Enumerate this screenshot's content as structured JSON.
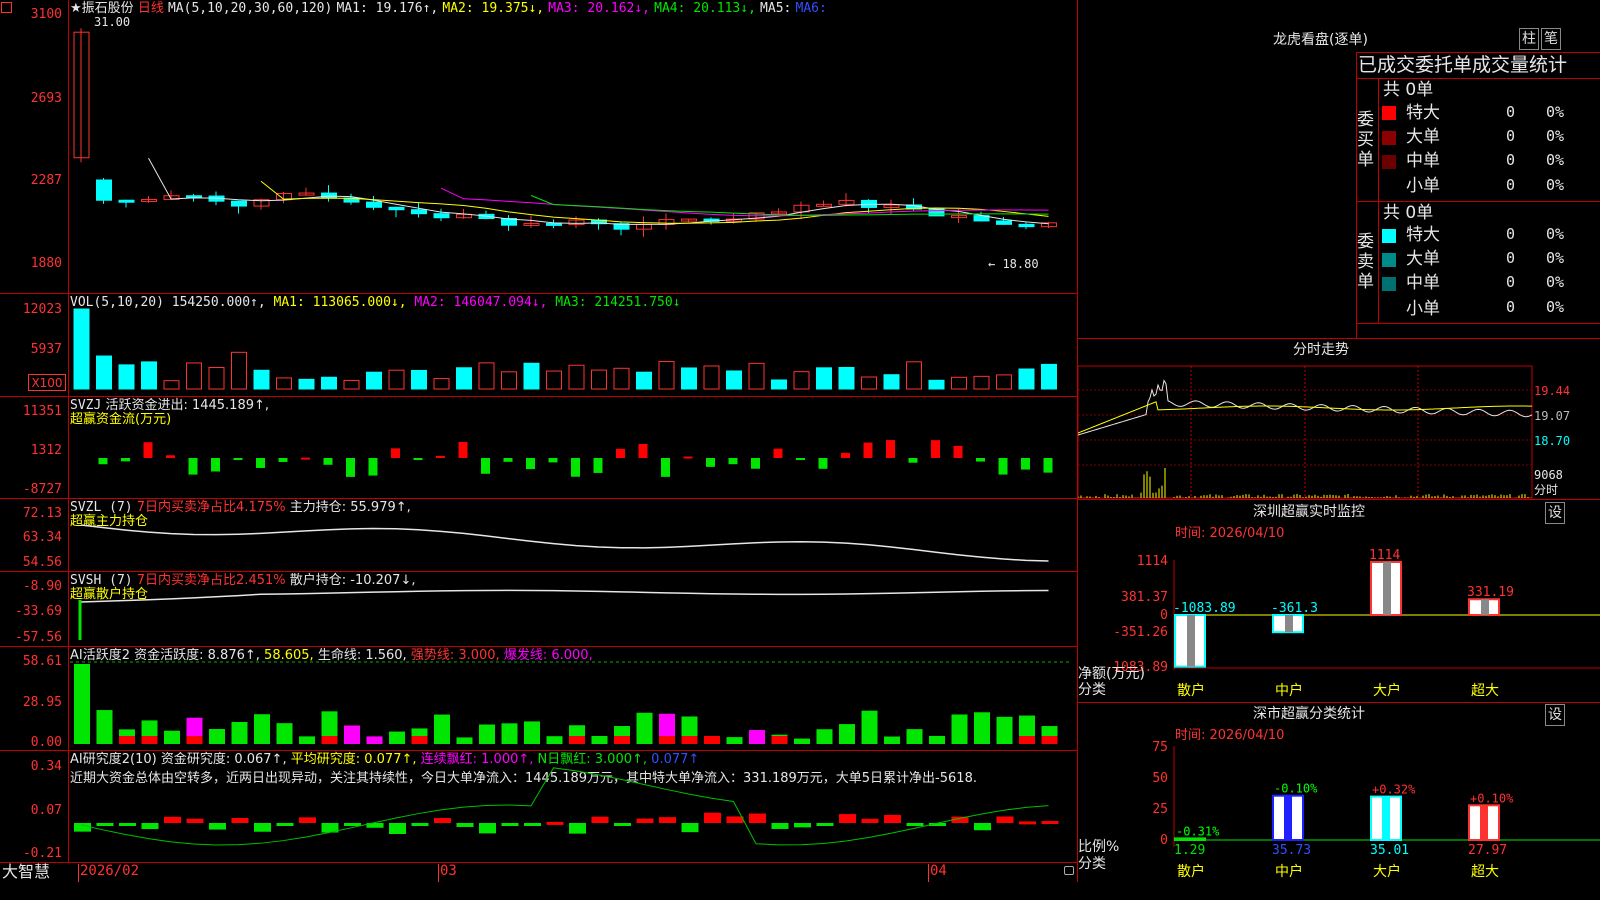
{
  "app": {
    "name": "大智慧"
  },
  "stock": {
    "name": "振石股份",
    "star": "★",
    "period": "日线"
  },
  "kline": {
    "ma_text": "MA(5,10,20,30,60,120)",
    "ma1": "MA1: 19.176↑,",
    "ma2": "MA2: 19.375↓,",
    "ma3": "MA3: 20.162↓,",
    "ma4": "MA4: 20.113↓,",
    "ma5": "MA5:",
    "ma6": "MA6:",
    "high_note": "31.00",
    "low_note": "18.80",
    "ylabels": [
      "3100",
      "2693",
      "2287",
      "1880"
    ]
  },
  "vol": {
    "title": "VOL(5,10,20)",
    "value": "154250.000↑,",
    "ma1": "MA1: 113065.000↓,",
    "ma2": "MA2: 146047.094↓,",
    "ma3": "MA3: 214251.750↓",
    "ylabels": [
      "12023",
      "5937"
    ],
    "unit": "X100"
  },
  "svzj": {
    "title": "SVZJ",
    "label": "活跃资金进出: 1445.189↑,",
    "sub": "超赢资金流(万元)",
    "ylabels": [
      "11351",
      "1312",
      "-8727"
    ]
  },
  "svzl": {
    "title": "SVZL (7)",
    "l1": "7日内买卖净占比4.175%",
    "l2": "主力持仓: 55.979↑,",
    "sub": "超赢主力持仓",
    "ylabels": [
      "72.13",
      "63.34",
      "54.56"
    ]
  },
  "svsh": {
    "title": "SVSH (7)",
    "l1": "7日内买卖净占比2.451%",
    "l2": "散户持仓: -10.207↓,",
    "sub": "超赢散户持仓",
    "ylabels": [
      "-8.90",
      "-33.69",
      "-57.56"
    ]
  },
  "ai1": {
    "title": "AI活跃度2",
    "l1": "资金活跃度: 8.876↑,",
    "l2": "58.605,",
    "l3": "生命线: 1.560,",
    "l4": "强势线: 3.000,",
    "l5": "爆发线: 6.000,",
    "ylabels": [
      "58.61",
      "28.95",
      "0.00"
    ]
  },
  "ai2": {
    "title": "AI研究度2(10)",
    "l1": "资金研究度: 0.067↑,",
    "l2": "平均研究度: 0.077↑,",
    "l3": "连续飘红: 1.000↑,",
    "l4": "N日飘红: 3.000↑,",
    "l5": "0.077↑",
    "comment": "近期大资金总体由空转多，近两日出现异动，关注其持续性，今日大单净流入：1445.189万元，其中特大单净流入：331.189万元，大单5日累计净出-5618.",
    "ylabels": [
      "0.34",
      "0.07",
      "-0.21"
    ]
  },
  "xaxis": {
    "labels": [
      "2026/02",
      "03",
      "04"
    ]
  },
  "lhb": {
    "title": "龙虎看盘(逐单)",
    "btn1": "柱",
    "btn2": "笔",
    "header": "已成交委托单成交量统计",
    "buy": {
      "side": "委买单",
      "total": "共 0单",
      "rows": [
        {
          "name": "特大",
          "count": "0",
          "pct": "0%",
          "color": "#ff0000"
        },
        {
          "name": "大单",
          "count": "0",
          "pct": "0%",
          "color": "#8b0000"
        },
        {
          "name": "中单",
          "count": "0",
          "pct": "0%",
          "color": "#6b0000"
        },
        {
          "name": "小单",
          "count": "0",
          "pct": "0%",
          "color": "#000000"
        }
      ]
    },
    "sell": {
      "side": "委卖单",
      "total": "共 0单",
      "rows": [
        {
          "name": "特大",
          "count": "0",
          "pct": "0%",
          "color": "#00ffff"
        },
        {
          "name": "大单",
          "count": "0",
          "pct": "0%",
          "color": "#008b8b"
        },
        {
          "name": "中单",
          "count": "0",
          "pct": "0%",
          "color": "#007070"
        },
        {
          "name": "小单",
          "count": "0",
          "pct": "0%",
          "color": "#000000"
        }
      ]
    }
  },
  "intraday": {
    "title": "分时走势",
    "ylabels": [
      "19.44",
      "19.07",
      "18.70"
    ],
    "vol_label": "9068",
    "vol_unit": "分时"
  },
  "monitor": {
    "title": "深圳超赢实时监控",
    "btn": "设",
    "time": "时间: 2026/04/10",
    "ylabels": [
      "1114",
      "381.37",
      "0",
      "-351.26",
      "-1083.89"
    ],
    "side_l1": "净额(万元)",
    "side_l2": "分类",
    "cats": [
      "散户",
      "中户",
      "大户",
      "超大"
    ],
    "values": [
      -1083.89,
      -361.3,
      1114,
      331.19
    ],
    "value_labels": [
      "-1083.89",
      "-361.3",
      "1114",
      "331.19"
    ]
  },
  "classify": {
    "title": "深市超赢分类统计",
    "btn": "设",
    "time": "时间: 2026/04/10",
    "ylabels": [
      "75",
      "50",
      "25",
      "0"
    ],
    "side_l1": "比例%",
    "side_l2": "分类",
    "cats": [
      "散户",
      "中户",
      "大户",
      "超大"
    ],
    "values": [
      1.29,
      35.73,
      35.01,
      27.97
    ],
    "value_labels": [
      "1.29",
      "35.73",
      "35.01",
      "27.97"
    ],
    "change_labels": [
      "-0.31%",
      "-0.10%",
      "+0.32%",
      "+0.10%"
    ]
  }
}
